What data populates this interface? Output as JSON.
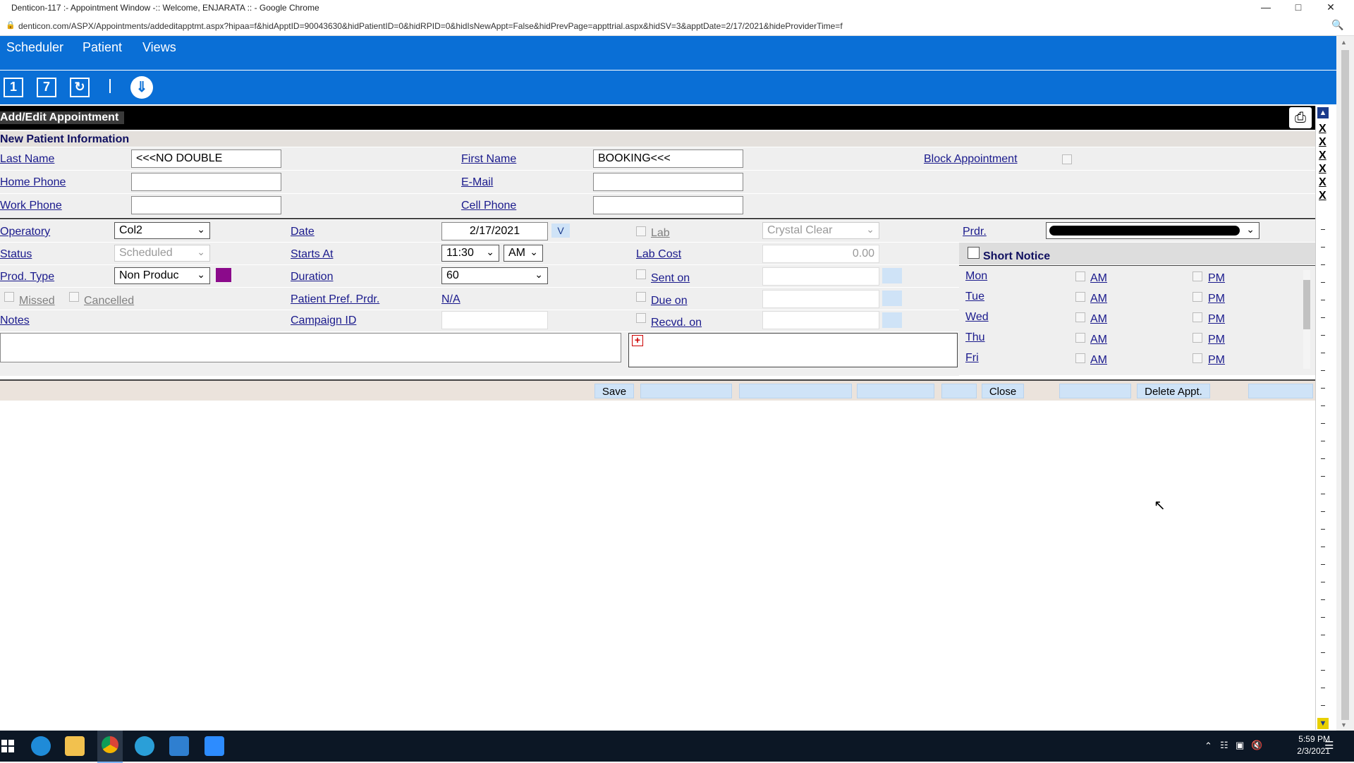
{
  "window": {
    "title": "Denticon-117 :- Appointment Window -:: Welcome, ENJARATA :: - Google Chrome",
    "url": "denticon.com/ASPX/Appointments/addeditapptmt.aspx?hipaa=f&hidApptID=90043630&hidPatientID=0&hidRPID=0&hidIsNewAppt=False&hidPrevPage=appttrial.aspx&hidSV=3&apptDate=2/17/2021&hideProviderTime=f"
  },
  "menu": {
    "scheduler": "Scheduler",
    "patient": "Patient",
    "views": "Views"
  },
  "toolbar": {
    "day_icon": "1",
    "week_icon": "7"
  },
  "header": {
    "title": "Add/Edit Appointment"
  },
  "section": {
    "title": "New Patient Information"
  },
  "patient": {
    "last_name_label": "Last Name",
    "last_name_value": "<<<NO DOUBLE",
    "first_name_label": "First Name",
    "first_name_value": "BOOKING<<<",
    "home_phone_label": "Home Phone",
    "home_phone_value": "",
    "email_label": "E-Mail",
    "email_value": "",
    "work_phone_label": "Work Phone",
    "work_phone_value": "",
    "cell_phone_label": "Cell Phone",
    "cell_phone_value": "",
    "block_appt_label": "Block Appointment"
  },
  "appt": {
    "operatory_label": "Operatory",
    "operatory_value": "Col2",
    "status_label": "Status",
    "status_value": "Scheduled",
    "prod_type_label": "Prod. Type",
    "prod_type_value": "Non Produc",
    "missed_label": "Missed",
    "cancelled_label": "Cancelled",
    "notes_label": "Notes",
    "date_label": "Date",
    "date_value": "2/17/2021",
    "date_btn": "V",
    "starts_label": "Starts At",
    "starts_time": "11:30",
    "starts_ampm": "AM",
    "duration_label": "Duration",
    "duration_value": "60",
    "pref_prdr_label": "Patient Pref. Prdr.",
    "pref_prdr_value": "N/A",
    "campaign_label": "Campaign ID",
    "lab_label": "Lab",
    "lab_value": "Crystal Clear",
    "lab_cost_label": "Lab Cost",
    "lab_cost_value": "0.00",
    "sent_label": "Sent on",
    "due_label": "Due on",
    "recvd_label": "Recvd. on",
    "prdr_label": "Prdr.",
    "short_notice_label": "Short Notice"
  },
  "days": [
    {
      "day": "Mon",
      "am": "AM",
      "pm": "PM"
    },
    {
      "day": "Tue",
      "am": "AM",
      "pm": "PM"
    },
    {
      "day": "Wed",
      "am": "AM",
      "pm": "PM"
    },
    {
      "day": "Thu",
      "am": "AM",
      "pm": "PM"
    },
    {
      "day": "Fri",
      "am": "AM",
      "pm": "PM"
    }
  ],
  "buttons": {
    "save": "Save",
    "close": "Close",
    "delete": "Delete Appt."
  },
  "taskbar": {
    "time": "5:59 PM",
    "date": "2/3/2021"
  },
  "colors": {
    "brand_blue": "#0a6fd6",
    "prod_type_swatch": "#8b0a8b"
  }
}
